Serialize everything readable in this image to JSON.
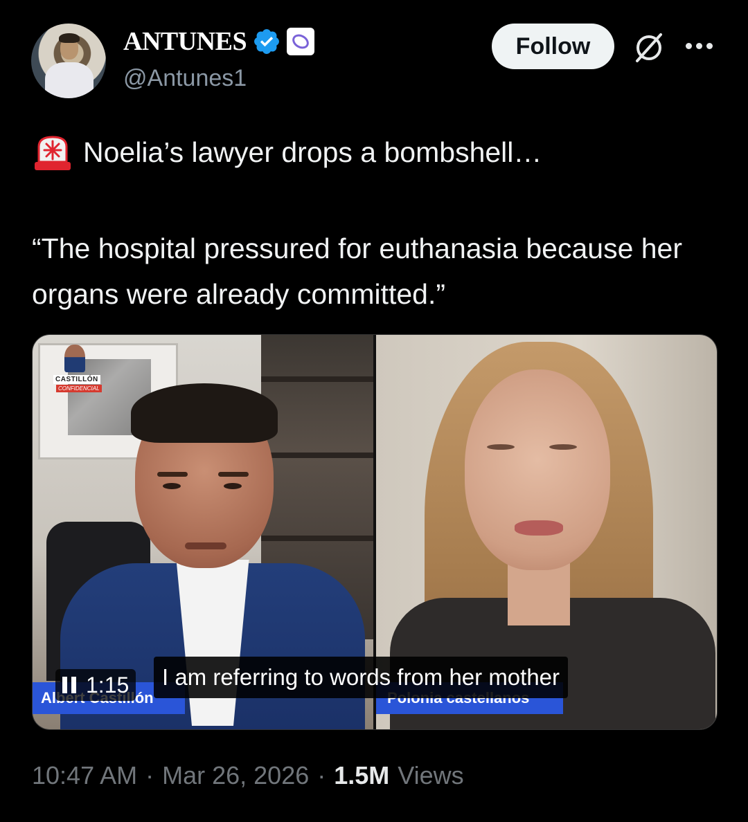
{
  "author": {
    "display_name": "ANTUNES",
    "handle": "@Antunes1",
    "verified_color": "#1d9bf0"
  },
  "actions": {
    "follow_label": "Follow",
    "grok_icon": "grok-icon",
    "more_icon": "more-icon"
  },
  "tweet": {
    "line1": "Noelia’s lawyer drops a bombshell…",
    "quote": "“The hospital pressured for euthanasia because her organs were already committed.”",
    "lead_icon": "siren-icon"
  },
  "video": {
    "channel_logo_line1": "CASTILLÓN",
    "channel_logo_line2": "CONFIDENCIAL",
    "left_name": "Albert Castillón",
    "right_name": "Polonia castellanos",
    "subtitle": "I am referring to words from her mother",
    "timer": "1:15",
    "state": "playing",
    "tag_color": "#2a55d8"
  },
  "meta": {
    "time": "10:47 AM",
    "sep1": "·",
    "date": "Mar 26, 2026",
    "sep2": "·",
    "views_count": "1.5M",
    "views_label": "Views"
  }
}
